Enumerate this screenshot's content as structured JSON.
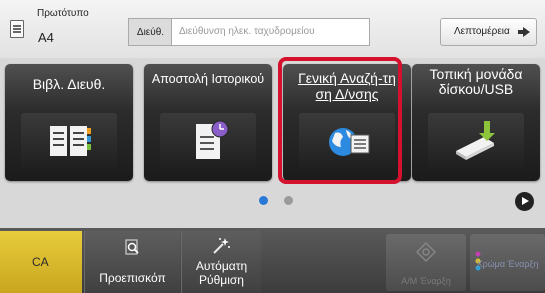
{
  "header": {
    "original_label": "Πρωτότυπο",
    "original_value": "A4",
    "address_label": "Διεύθ.",
    "address_placeholder": "Διεύθυνση ηλεκ. ταχυδρομείου",
    "details_label": "Λεπτομέρεια"
  },
  "tiles": [
    {
      "label": "Βιβλ. Διευθ.",
      "icon": "address-book-icon"
    },
    {
      "label": "Αποστολή Ιστορικού",
      "icon": "history-document-icon"
    },
    {
      "label": "Γενική Αναζή-τηση Δ/νσης",
      "icon": "global-search-icon"
    },
    {
      "label": "Τοπική μονάδα δίσκου/USB",
      "icon": "usb-drive-icon"
    }
  ],
  "pagination": {
    "current_page": 1,
    "total_pages": 2
  },
  "bottom": {
    "ca_label": "CA",
    "preview_label": "Προεπισκόπ",
    "auto_label": "Αυτόματη Ρύθμιση",
    "bw_label": "Α/Μ Έναρξη",
    "color_label": "Χρώμα Έναρξη"
  },
  "colors": {
    "highlight": "#d4122e",
    "ca_button": "#d8b82c",
    "active_dot": "#2878d8"
  }
}
